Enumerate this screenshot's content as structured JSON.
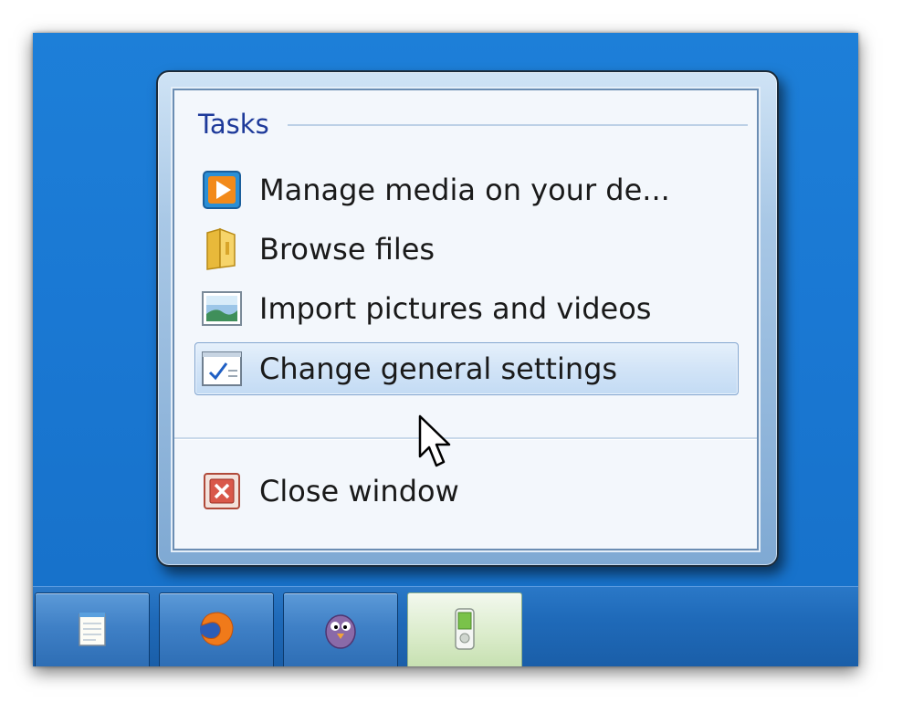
{
  "jump_list": {
    "section_title": "Tasks",
    "tasks": [
      {
        "label": "Manage media on your de...",
        "icon": "media-player-icon",
        "hover": false
      },
      {
        "label": "Browse files",
        "icon": "folder-icon",
        "hover": false
      },
      {
        "label": "Import pictures and videos",
        "icon": "picture-icon",
        "hover": false
      },
      {
        "label": "Change general settings",
        "icon": "settings-checklist-icon",
        "hover": true
      }
    ],
    "close_label": "Close window"
  },
  "taskbar": {
    "buttons": [
      {
        "app": "notepad",
        "icon": "notepad-icon",
        "active": false
      },
      {
        "app": "firefox",
        "icon": "firefox-icon",
        "active": false
      },
      {
        "app": "pidgin",
        "icon": "pidgin-icon",
        "active": false
      },
      {
        "app": "device",
        "icon": "media-device-icon",
        "active": true
      }
    ]
  },
  "colors": {
    "desktop": "#1a78d3",
    "header_text": "#1e3a9a",
    "hover_border": "#7da2ce"
  }
}
